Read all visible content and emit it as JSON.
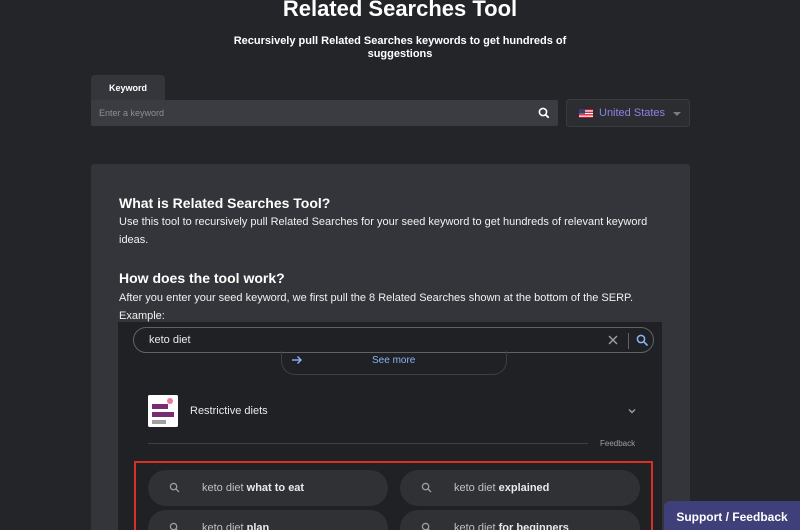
{
  "header": {
    "title": "Related Searches Tool",
    "subtitle": "Recursively pull Related Searches keywords to get hundreds of suggestions"
  },
  "search": {
    "tab_label": "Keyword",
    "placeholder": "Enter a keyword",
    "value": ""
  },
  "country": {
    "label": "United States"
  },
  "info": {
    "what_heading": "What is Related Searches Tool?",
    "what_text": "Use this tool to recursively pull Related Searches for your seed keyword to get hundreds of relevant keyword ideas.",
    "how_heading": "How does the tool work?",
    "how_text": "After you enter your seed keyword, we first pull the 8 Related Searches shown at the bottom of the SERP. Example:"
  },
  "example": {
    "query": "keto diet",
    "see_more": "See more",
    "diet_label": "Restrictive diets",
    "feedback": "Feedback",
    "chips": [
      {
        "prefix": "keto diet ",
        "bold": "what to eat"
      },
      {
        "prefix": "keto diet ",
        "bold": "explained"
      },
      {
        "prefix": "keto diet ",
        "bold": "plan"
      },
      {
        "prefix": "keto diet ",
        "bold": "for beginners"
      }
    ]
  },
  "support": {
    "label": "Support / Feedback"
  },
  "colors": {
    "background": "#242529",
    "card": "#34353a",
    "accent": "#8b83e6",
    "highlight": "#d93025",
    "support": "#3f4079"
  }
}
